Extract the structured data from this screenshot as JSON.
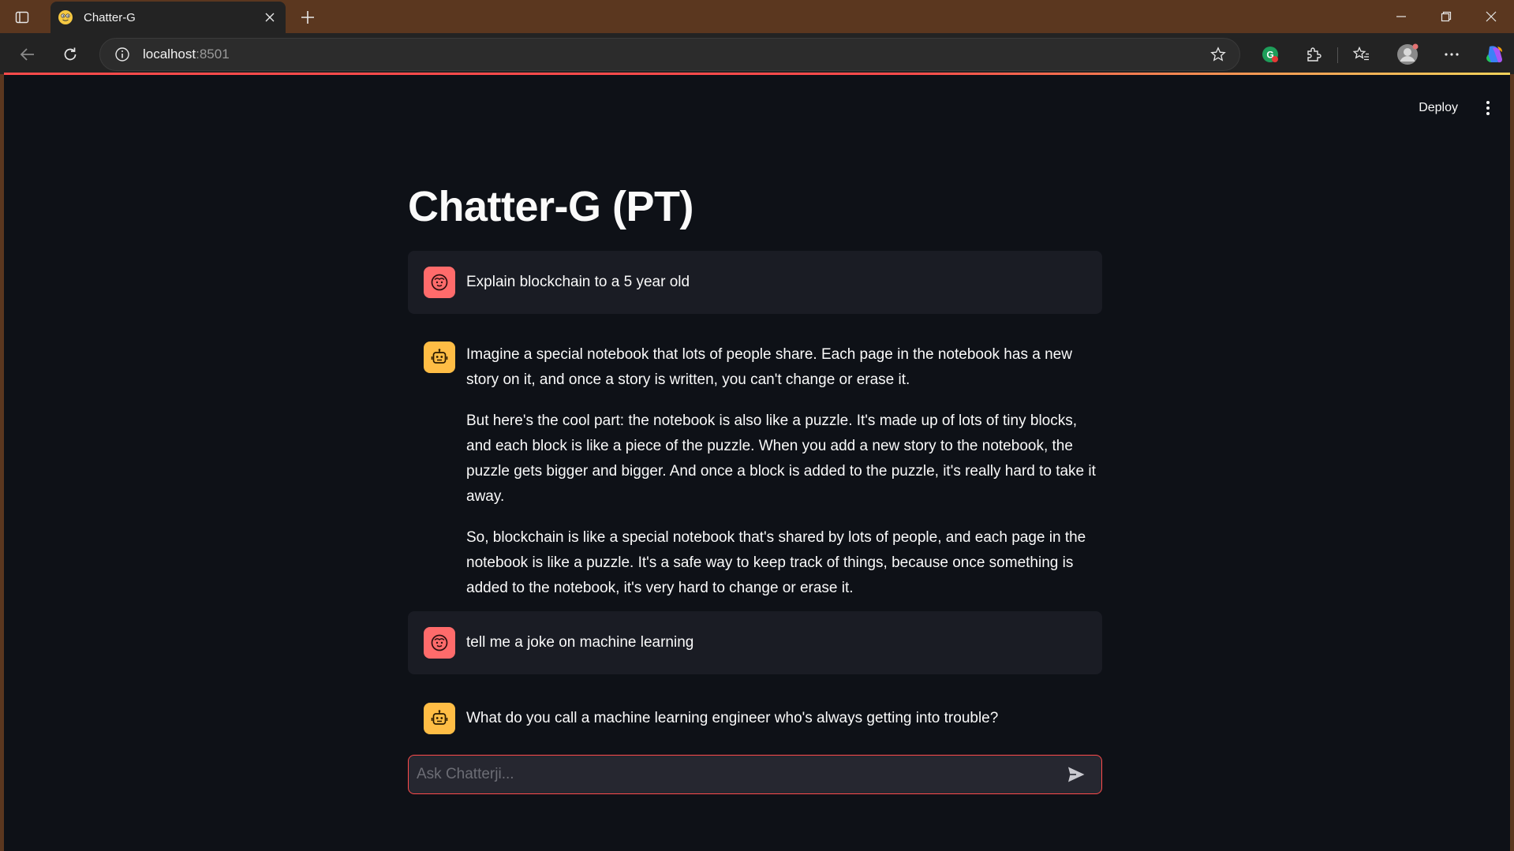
{
  "browser": {
    "tab_title": "Chatter-G",
    "url_host": "localhost",
    "url_port": ":8501"
  },
  "header": {
    "deploy_label": "Deploy"
  },
  "page": {
    "title": "Chatter-G (PT)"
  },
  "chat": {
    "messages": [
      {
        "role": "user",
        "paragraphs": [
          "Explain blockchain to a 5 year old"
        ]
      },
      {
        "role": "assistant",
        "paragraphs": [
          "Imagine a special notebook that lots of people share. Each page in the notebook has a new story on it, and once a story is written, you can't change or erase it.",
          "But here's the cool part: the notebook is also like a puzzle. It's made up of lots of tiny blocks, and each block is like a piece of the puzzle. When you add a new story to the notebook, the puzzle gets bigger and bigger. And once a block is added to the puzzle, it's really hard to take it away.",
          "So, blockchain is like a special notebook that's shared by lots of people, and each page in the notebook is like a puzzle. It's a safe way to keep track of things, because once something is added to the notebook, it's very hard to change or erase it."
        ]
      },
      {
        "role": "user",
        "paragraphs": [
          "tell me a joke on machine learning"
        ]
      },
      {
        "role": "assistant",
        "paragraphs": [
          "What do you call a machine learning engineer who's always getting into trouble?"
        ]
      }
    ],
    "input_placeholder": "Ask Chatterji...",
    "input_value": ""
  },
  "icons": {
    "user_avatar": "user-face-icon",
    "assistant_avatar": "robot-icon",
    "send": "send-icon"
  },
  "colors": {
    "page_bg": "#0e1117",
    "user_msg_bg": "#1a1c24",
    "user_avatar": "#ff6b6b",
    "assistant_avatar": "#ffbd45",
    "accent": "#ff4b4b",
    "chrome_frame": "#5b371f"
  }
}
